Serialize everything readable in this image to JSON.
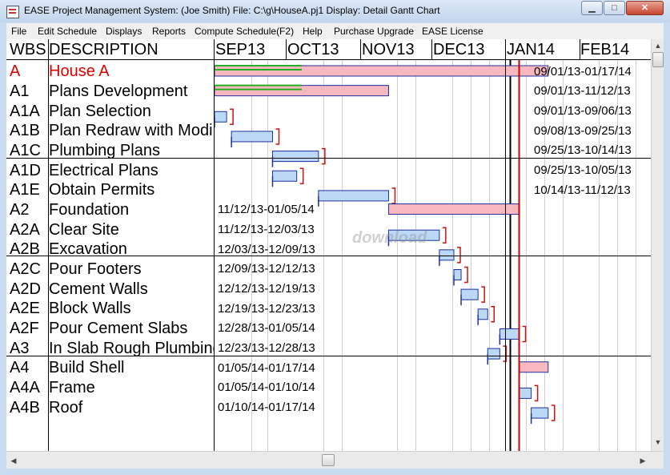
{
  "window": {
    "title": "EASE Project Management System:  (Joe Smith) File:  C:\\g\\HouseA.pj1  Display: Detail Gantt Chart",
    "minimize_glyph": "▁",
    "maximize_glyph": "□",
    "close_glyph": "✕"
  },
  "menu": [
    "File",
    "Edit Schedule",
    "Displays",
    "Reports",
    "Compute Schedule(F2)",
    "Help",
    "Purchase Upgrade",
    "EASE License"
  ],
  "header": {
    "wbs": "WBS",
    "description": "DESCRIPTION",
    "months": [
      "SEP13",
      "OCT13",
      "NOV13",
      "DEC13",
      "JAN14",
      "FEB14"
    ]
  },
  "tasks": [
    {
      "wbs": "A",
      "description": "House A",
      "dates": "09/01/13-01/17/14",
      "start": "2013-09-01",
      "end": "2014-01-17",
      "summary": true
    },
    {
      "wbs": "A1",
      "description": "Plans Development",
      "dates": "09/01/13-11/12/13",
      "start": "2013-09-01",
      "end": "2013-11-12",
      "summary": true
    },
    {
      "wbs": "A1A",
      "description": "Plan Selection",
      "dates": "09/01/13-09/06/13",
      "start": "2013-09-01",
      "end": "2013-09-06",
      "summary": false
    },
    {
      "wbs": "A1B",
      "description": "Plan Redraw with Modi",
      "dates": "09/08/13-09/25/13",
      "start": "2013-09-08",
      "end": "2013-09-25",
      "summary": false
    },
    {
      "wbs": "A1C",
      "description": "Plumbing Plans",
      "dates": "09/25/13-10/14/13",
      "start": "2013-09-25",
      "end": "2013-10-14",
      "summary": false
    },
    {
      "wbs": "A1D",
      "description": "Electrical Plans",
      "dates": "09/25/13-10/05/13",
      "start": "2013-09-25",
      "end": "2013-10-05",
      "summary": false
    },
    {
      "wbs": "A1E",
      "description": "Obtain Permits",
      "dates": "10/14/13-11/12/13",
      "start": "2013-10-14",
      "end": "2013-11-12",
      "summary": false
    },
    {
      "wbs": "A2",
      "description": "Foundation",
      "dates": "11/12/13-01/05/14",
      "start": "2013-11-12",
      "end": "2014-01-05",
      "summary": true
    },
    {
      "wbs": "A2A",
      "description": "Clear Site",
      "dates": "11/12/13-12/03/13",
      "start": "2013-11-12",
      "end": "2013-12-03",
      "summary": false
    },
    {
      "wbs": "A2B",
      "description": "Excavation",
      "dates": "12/03/13-12/09/13",
      "start": "2013-12-03",
      "end": "2013-12-09",
      "summary": false
    },
    {
      "wbs": "A2C",
      "description": "Pour Footers",
      "dates": "12/09/13-12/12/13",
      "start": "2013-12-09",
      "end": "2013-12-12",
      "summary": false
    },
    {
      "wbs": "A2D",
      "description": "Cement Walls",
      "dates": "12/12/13-12/19/13",
      "start": "2013-12-12",
      "end": "2013-12-19",
      "summary": false
    },
    {
      "wbs": "A2E",
      "description": "Block Walls",
      "dates": "12/19/13-12/23/13",
      "start": "2013-12-19",
      "end": "2013-12-23",
      "summary": false
    },
    {
      "wbs": "A2F",
      "description": "Pour Cement Slabs",
      "dates": "12/28/13-01/05/14",
      "start": "2013-12-28",
      "end": "2014-01-05",
      "summary": false
    },
    {
      "wbs": "A3",
      "description": "In Slab Rough Plumbing",
      "dates": "12/23/13-12/28/13",
      "start": "2013-12-23",
      "end": "2013-12-28",
      "summary": false
    },
    {
      "wbs": "A4",
      "description": "Build Shell",
      "dates": "01/05/14-01/17/14",
      "start": "2014-01-05",
      "end": "2014-01-17",
      "summary": true
    },
    {
      "wbs": "A4A",
      "description": "Frame",
      "dates": "01/05/14-01/10/14",
      "start": "2014-01-05",
      "end": "2014-01-10",
      "summary": false
    },
    {
      "wbs": "A4B",
      "description": "Roof",
      "dates": "01/10/14-01/17/14",
      "start": "2014-01-10",
      "end": "2014-01-17",
      "summary": false
    }
  ],
  "watermark": "download",
  "colors": {
    "summary_bar": "#f7b9bf",
    "task_bar": "#bcd8f7",
    "bar_border": "#1f2f9f",
    "slack_bracket": "#cc1111",
    "progress_line": "#22b022",
    "today_line": "#cc0000",
    "highlight_text": "#e00000"
  },
  "timeline": {
    "today": "2014-01-05"
  }
}
